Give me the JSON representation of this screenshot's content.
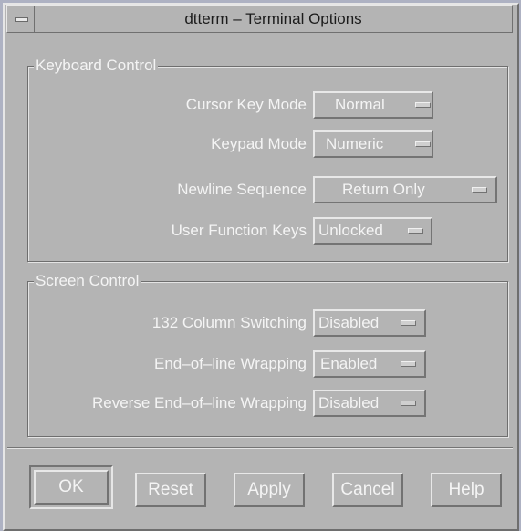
{
  "window": {
    "title": "dtterm – Terminal Options"
  },
  "keyboard": {
    "legend": "Keyboard Control",
    "rows": [
      {
        "label": "Cursor Key Mode",
        "value": "Normal"
      },
      {
        "label": "Keypad Mode",
        "value": "Numeric"
      },
      {
        "label": "Newline Sequence",
        "value": "Return Only"
      },
      {
        "label": "User Function Keys",
        "value": "Unlocked"
      }
    ]
  },
  "screen": {
    "legend": "Screen Control",
    "rows": [
      {
        "label": "132 Column Switching",
        "value": "Disabled"
      },
      {
        "label": "End–of–line Wrapping",
        "value": "Enabled"
      },
      {
        "label": "Reverse End–of–line Wrapping",
        "value": "Disabled"
      }
    ]
  },
  "buttons": {
    "ok": "OK",
    "reset": "Reset",
    "apply": "Apply",
    "cancel": "Cancel",
    "help": "Help"
  },
  "icons": {
    "window_menu": "window-menu-icon",
    "option_indicator": "option-menu-indicator-icon"
  }
}
